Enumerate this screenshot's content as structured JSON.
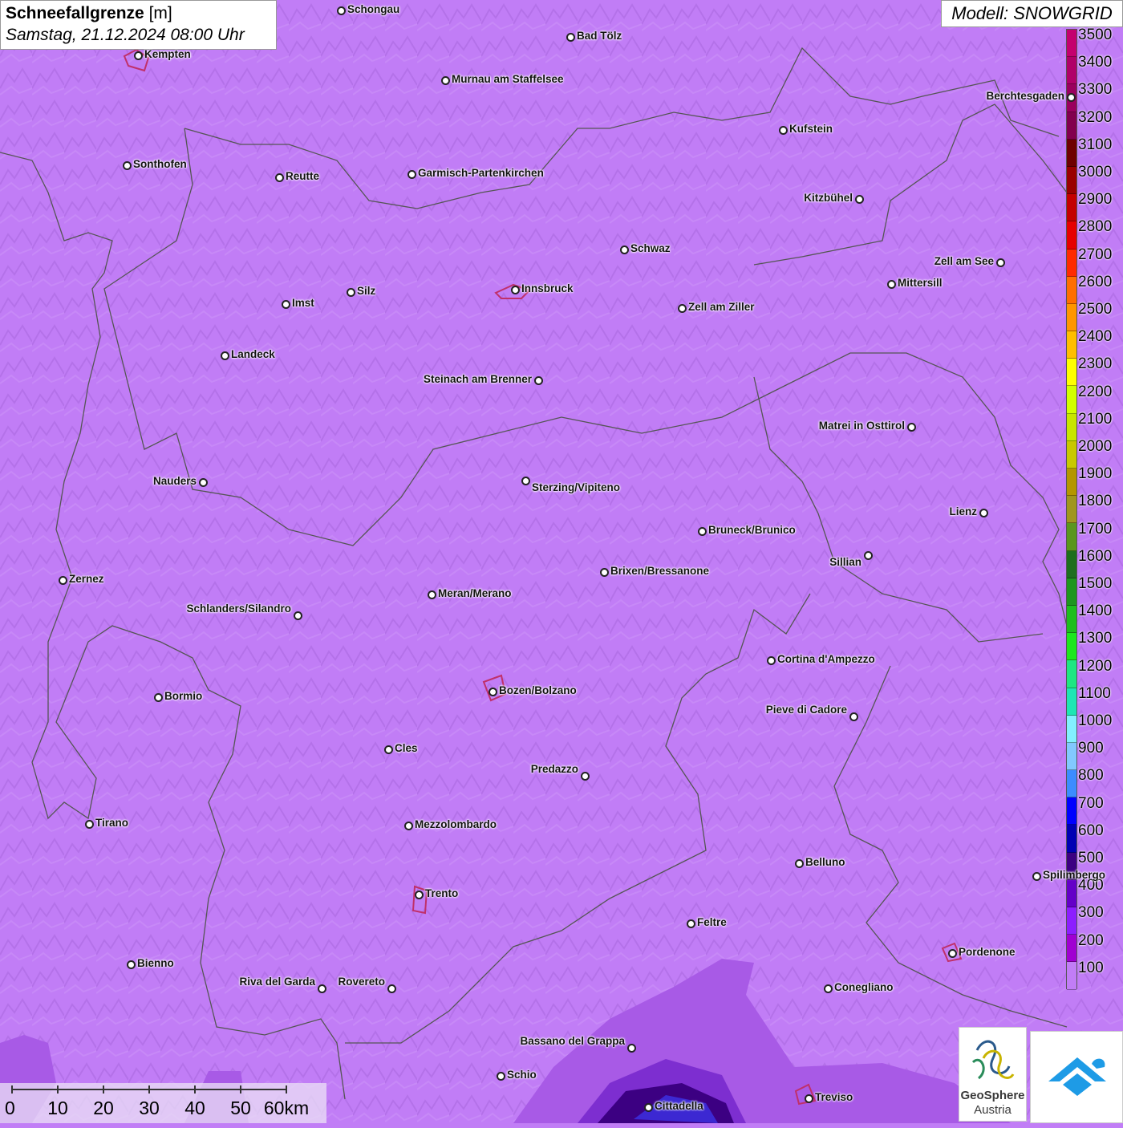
{
  "header": {
    "title_bold": "Schneefallgrenze",
    "title_unit": " [m]",
    "datetime": "Samstag, 21.12.2024 08:00 Uhr"
  },
  "model": {
    "label": "Modell: SNOWGRID"
  },
  "legend": {
    "levels": [
      {
        "value": "3500",
        "color": "#c4006e"
      },
      {
        "value": "3400",
        "color": "#b00068"
      },
      {
        "value": "3300",
        "color": "#9a005e"
      },
      {
        "value": "3200",
        "color": "#82004e"
      },
      {
        "value": "3100",
        "color": "#6e0000"
      },
      {
        "value": "3000",
        "color": "#9a0000"
      },
      {
        "value": "2900",
        "color": "#c40000"
      },
      {
        "value": "2800",
        "color": "#e60000"
      },
      {
        "value": "2700",
        "color": "#ff2a00"
      },
      {
        "value": "2600",
        "color": "#ff6e00"
      },
      {
        "value": "2500",
        "color": "#ff9600"
      },
      {
        "value": "2400",
        "color": "#ffbe00"
      },
      {
        "value": "2300",
        "color": "#ffff00"
      },
      {
        "value": "2200",
        "color": "#d2ff00"
      },
      {
        "value": "2100",
        "color": "#c8e600"
      },
      {
        "value": "2000",
        "color": "#c8c800"
      },
      {
        "value": "1900",
        "color": "#b49600"
      },
      {
        "value": "1800",
        "color": "#a0961e"
      },
      {
        "value": "1700",
        "color": "#5a961e"
      },
      {
        "value": "1600",
        "color": "#1e6e1e"
      },
      {
        "value": "1500",
        "color": "#1e961e"
      },
      {
        "value": "1400",
        "color": "#1ebe1e"
      },
      {
        "value": "1300",
        "color": "#1ee61e"
      },
      {
        "value": "1200",
        "color": "#1ee682"
      },
      {
        "value": "1100",
        "color": "#1ee6b4"
      },
      {
        "value": "1000",
        "color": "#82f0ff"
      },
      {
        "value": "900",
        "color": "#82c8ff"
      },
      {
        "value": "800",
        "color": "#3c8cff"
      },
      {
        "value": "700",
        "color": "#0000ff"
      },
      {
        "value": "600",
        "color": "#0000b4"
      },
      {
        "value": "500",
        "color": "#3c0082"
      },
      {
        "value": "400",
        "color": "#6400c8"
      },
      {
        "value": "300",
        "color": "#8c1eff"
      },
      {
        "value": "200",
        "color": "#a000d2"
      },
      {
        "value": "100",
        "color": "#c17df6"
      }
    ]
  },
  "cities": [
    {
      "name": "Schongau"
    },
    {
      "name": "Bad Tölz"
    },
    {
      "name": "Kempten"
    },
    {
      "name": "Murnau am Staffelsee"
    },
    {
      "name": "Berchtesgaden"
    },
    {
      "name": "Kufstein"
    },
    {
      "name": "Sonthofen"
    },
    {
      "name": "Reutte"
    },
    {
      "name": "Garmisch-Partenkirchen"
    },
    {
      "name": "Kitzbühel"
    },
    {
      "name": "Schwaz"
    },
    {
      "name": "Zell am See"
    },
    {
      "name": "Innsbruck"
    },
    {
      "name": "Mittersill"
    },
    {
      "name": "Imst"
    },
    {
      "name": "Silz"
    },
    {
      "name": "Zell am Ziller"
    },
    {
      "name": "Landeck"
    },
    {
      "name": "Steinach am Brenner"
    },
    {
      "name": "Matrei in Osttirol"
    },
    {
      "name": "Nauders"
    },
    {
      "name": "Sterzing/Vipiteno"
    },
    {
      "name": "Lienz"
    },
    {
      "name": "Bruneck/Brunico"
    },
    {
      "name": "Sillian"
    },
    {
      "name": "Zernez"
    },
    {
      "name": "Brixen/Bressanone"
    },
    {
      "name": "Meran/Merano"
    },
    {
      "name": "Schlanders/Silandro"
    },
    {
      "name": "Cortina d'Ampezzo"
    },
    {
      "name": "Bozen/Bolzano"
    },
    {
      "name": "Bormio"
    },
    {
      "name": "Pieve di Cadore"
    },
    {
      "name": "Cles"
    },
    {
      "name": "Predazzo"
    },
    {
      "name": "Tirano"
    },
    {
      "name": "Mezzolombardo"
    },
    {
      "name": "Belluno"
    },
    {
      "name": "Spilimbergo"
    },
    {
      "name": "Trento"
    },
    {
      "name": "Feltre"
    },
    {
      "name": "Pordenone"
    },
    {
      "name": "Bienno"
    },
    {
      "name": "Riva del Garda"
    },
    {
      "name": "Rovereto"
    },
    {
      "name": "Conegliano"
    },
    {
      "name": "Bassano del Grappa"
    },
    {
      "name": "Schio"
    },
    {
      "name": "Treviso"
    },
    {
      "name": "Cittadella"
    }
  ],
  "scale": {
    "labels": [
      "0",
      "10",
      "20",
      "30",
      "40",
      "50",
      "60km"
    ]
  },
  "logos": {
    "geosphere_name": "GeoSphere",
    "geosphere_sub": "Austria"
  }
}
